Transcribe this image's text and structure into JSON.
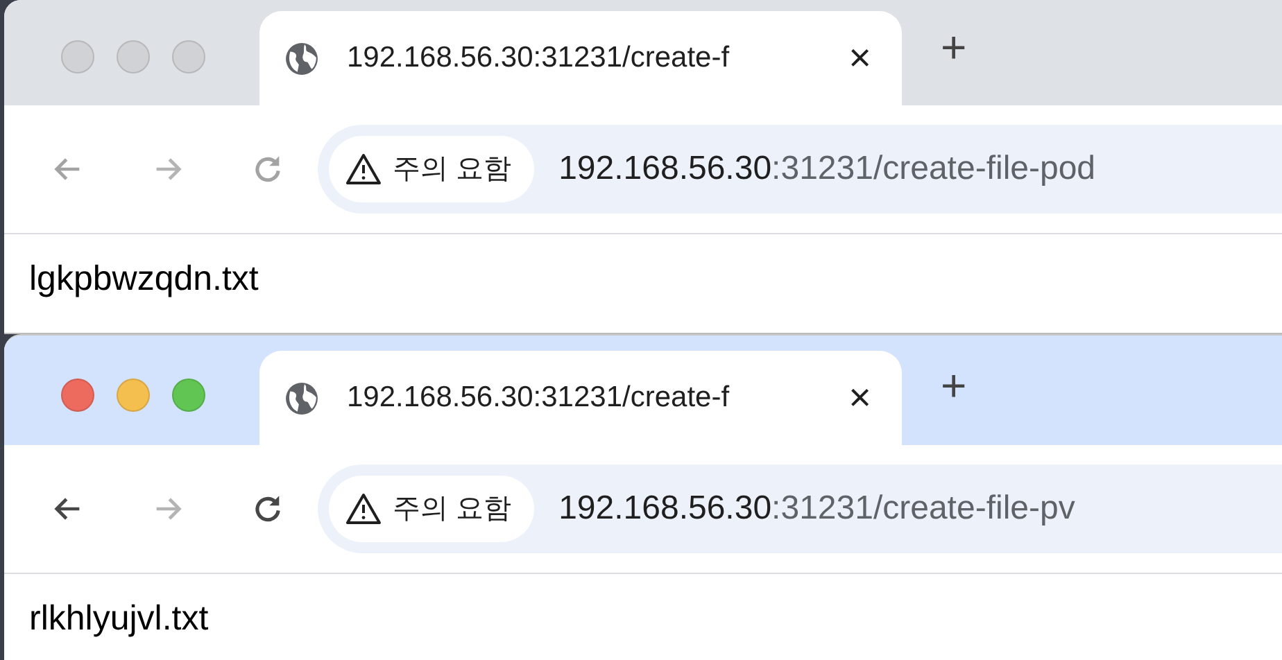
{
  "windows": [
    {
      "focused": false,
      "tab": {
        "title": "192.168.56.30:31231/create-f",
        "close": "×"
      },
      "new_tab": "+",
      "nav": {
        "back_disabled": false,
        "forward_disabled": true
      },
      "security_chip": "주의 요함",
      "address": {
        "host": "192.168.56.30",
        "path": ":31231/create-file-pod"
      },
      "content": "lgkpbwzqdn.txt"
    },
    {
      "focused": true,
      "tab": {
        "title": "192.168.56.30:31231/create-f",
        "close": "×"
      },
      "new_tab": "+",
      "nav": {
        "back_disabled": false,
        "forward_disabled": true
      },
      "security_chip": "주의 요함",
      "address": {
        "host": "192.168.56.30",
        "path": ":31231/create-file-pv"
      },
      "content": "rlkhlyujvl.txt"
    }
  ]
}
